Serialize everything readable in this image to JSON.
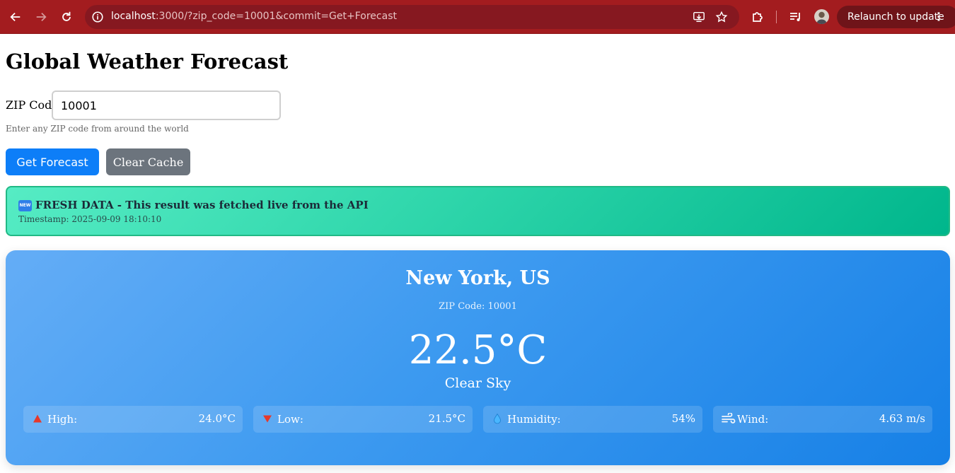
{
  "browser": {
    "url_host": "localhost",
    "url_rest": ":3000/?zip_code=10001&commit=Get+Forecast",
    "relaunch_label": "Relaunch to update",
    "colors": {
      "toolbar": "#a31c1f",
      "omnibox": "#861820"
    }
  },
  "page": {
    "title": "Global Weather Forecast",
    "zip_label": "ZIP Code",
    "zip_value": "10001",
    "zip_help": "Enter any ZIP code from around the world",
    "forecast_button": "Get Forecast",
    "clear_button": "Clear Cache"
  },
  "banner": {
    "badge": "NEW",
    "title": "FRESH DATA - This result was fetched live from the API",
    "timestamp": "Timestamp: 2025-09-09 18:10:10"
  },
  "weather": {
    "city": "New York, US",
    "zip_line": "ZIP Code: 10001",
    "temperature": "22.5°C",
    "condition": "Clear Sky",
    "stats": [
      {
        "icon": "triangle-up-icon",
        "label": "High:",
        "value": "24.0°C"
      },
      {
        "icon": "triangle-down-icon",
        "label": "Low:",
        "value": "21.5°C"
      },
      {
        "icon": "droplet-icon",
        "label": "Humidity:",
        "value": "54%"
      },
      {
        "icon": "wind-icon",
        "label": "Wind:",
        "value": "4.63 m/s"
      }
    ]
  }
}
